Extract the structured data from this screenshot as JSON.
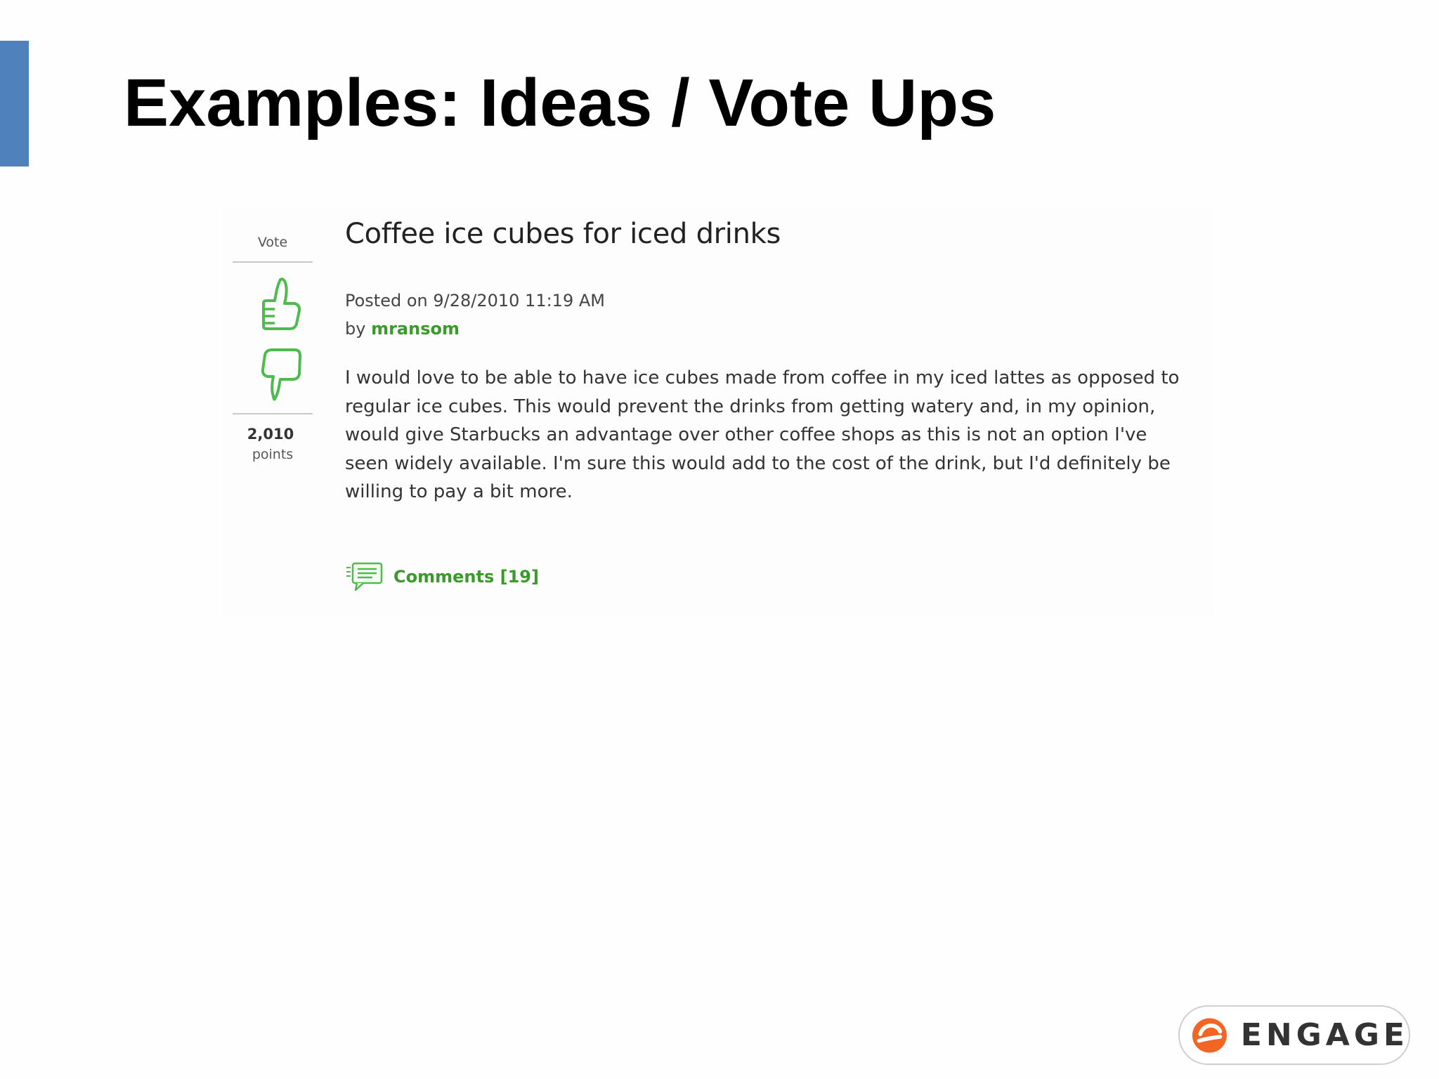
{
  "slide": {
    "title": "Examples: Ideas / Vote Ups",
    "accent_color": "#4f81bd"
  },
  "idea": {
    "vote_label": "Vote",
    "points_value": "2,010",
    "points_label": "points",
    "title": "Coffee ice cubes for iced drinks",
    "posted": "Posted on 9/28/2010 11:19 AM",
    "by_prefix": "by",
    "author": "mransom",
    "body": "I would love to be able to have ice cubes made from coffee in my iced lattes as opposed to regular ice cubes. This would prevent the drinks from getting watery and, in my opinion, would give Starbucks an advantage over other coffee shops as this is not an option I've seen widely available. I'm sure this would add to the cost of the drink, but I'd definitely be willing to pay a bit more.",
    "comments_label": "Comments [19]",
    "link_color": "#3a9a2a"
  },
  "icons": {
    "vote_up": "thumbs-up-icon",
    "vote_down": "thumbs-down-icon",
    "comments": "speech-bubble-icon",
    "logo": "engage-logo-icon"
  },
  "brand": {
    "name": "ENGAGE",
    "logo_color": "#f26522"
  }
}
